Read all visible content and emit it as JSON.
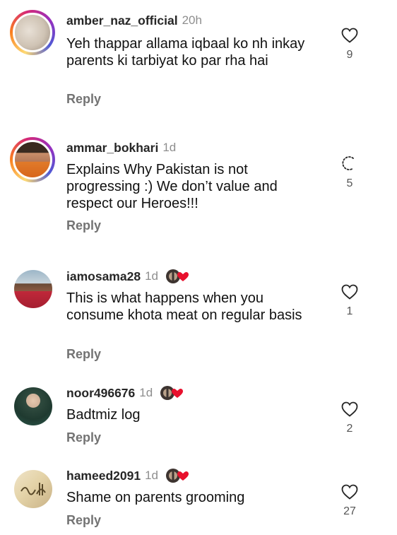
{
  "comments": [
    {
      "username": "amber_naz_official",
      "time": "20h",
      "text": "Yeh thappar allama iqbaal ko nh inkay parents ki tarbiyat ko par rha hai",
      "reply": "Reply",
      "likes": "9",
      "has_badge": false
    },
    {
      "username": "ammar_bokhari",
      "time": "1d",
      "text": "Explains Why Pakistan is not progressing :) We don’t value and respect our Heroes!!!",
      "reply": "Reply",
      "likes": "5",
      "has_badge": false
    },
    {
      "username": "iamosama28",
      "time": "1d",
      "text": "This is what happens when you consume khota meat on regular basis",
      "reply": "Reply",
      "likes": "1",
      "has_badge": true
    },
    {
      "username": "noor496676",
      "time": "1d",
      "text": "Badtmiz log",
      "reply": "Reply",
      "likes": "2",
      "has_badge": true
    },
    {
      "username": "hameed2091",
      "time": "1d",
      "text": "Shame on parents grooming",
      "reply": "Reply",
      "likes": "27",
      "has_badge": true
    }
  ],
  "icons": {
    "like": "heart-outline-icon",
    "loading": "spinner-icon",
    "badge": "avatar-heart-badge-icon"
  },
  "colors": {
    "story_ring_start": "#feda75",
    "story_ring_mid": "#d62976",
    "story_ring_end": "#4f5bd5",
    "username": "#262626",
    "secondary": "#8e8e8e",
    "reply": "#737373",
    "badge_heart": "#e8112d"
  }
}
